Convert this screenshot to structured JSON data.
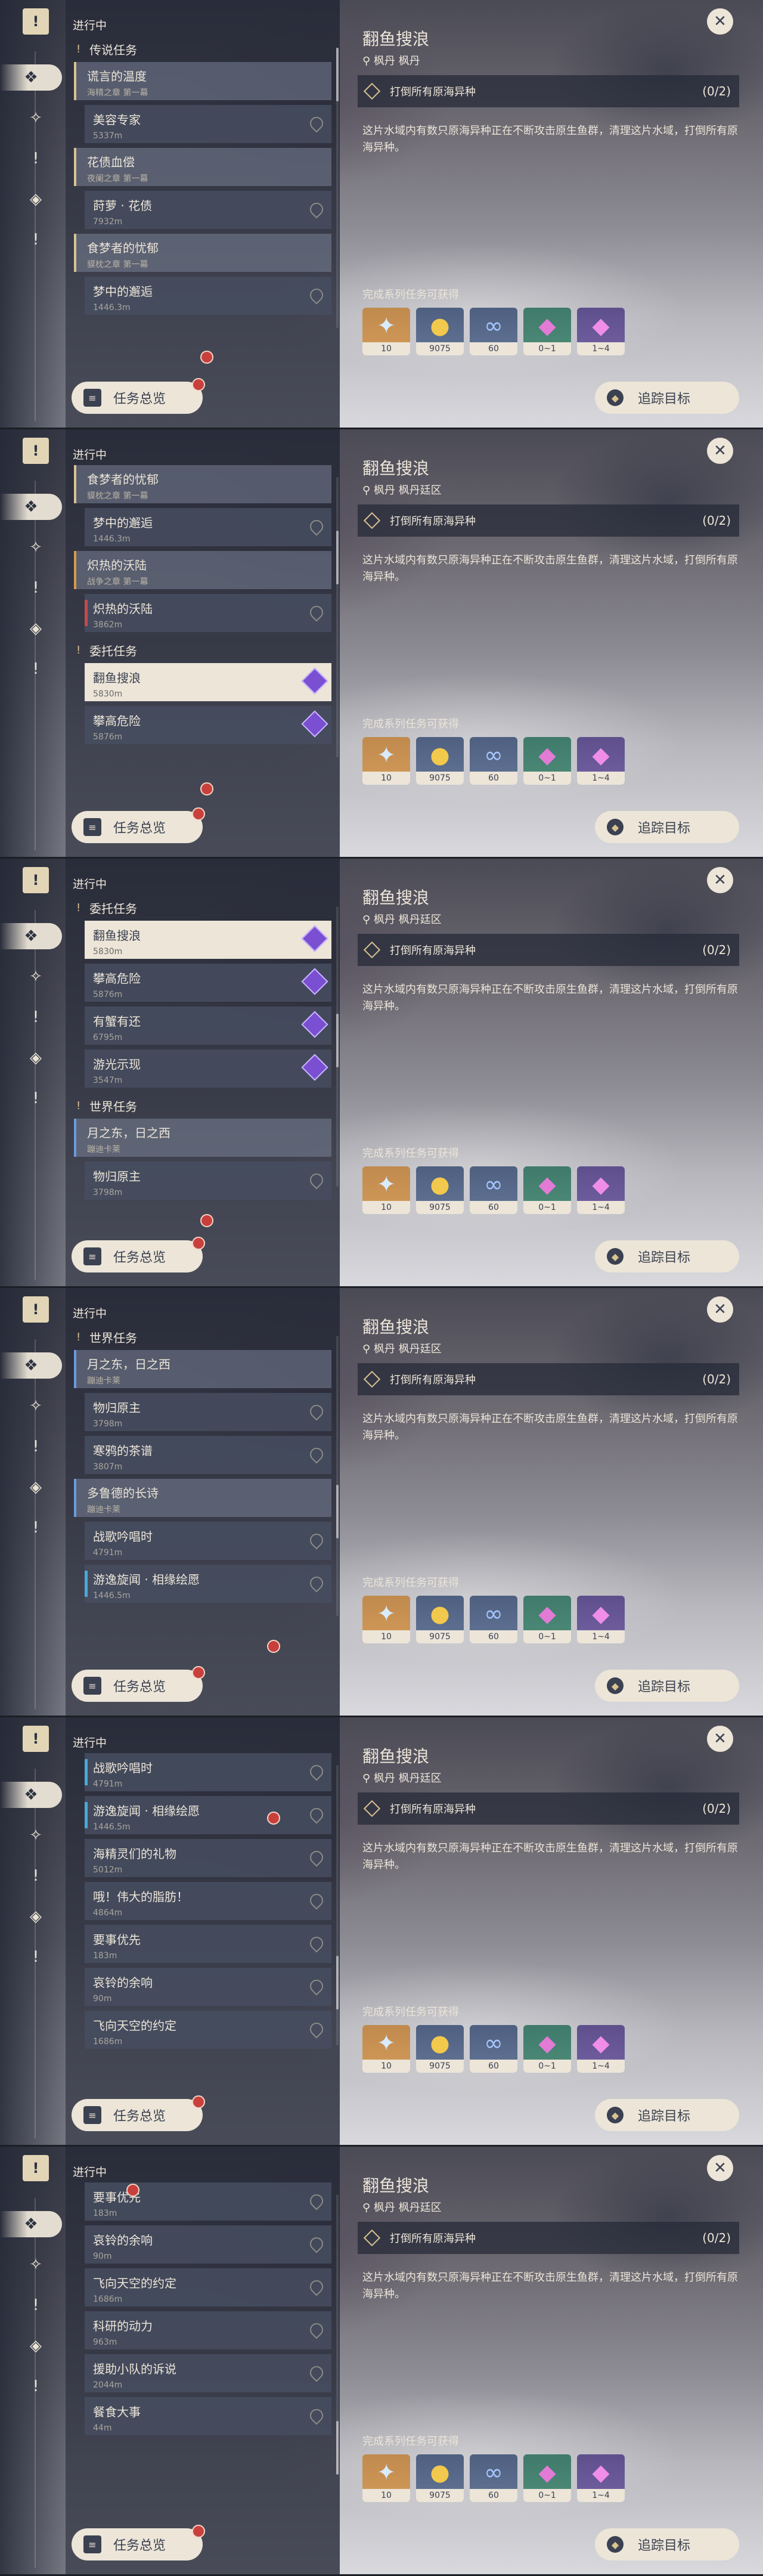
{
  "rail": {
    "top_icon": "!",
    "icons": [
      {
        "name": "quest-type-all-icon",
        "glyph": "❖"
      },
      {
        "name": "quest-type-archon-icon",
        "glyph": "✧"
      },
      {
        "name": "quest-type-story-icon",
        "glyph": "!"
      },
      {
        "name": "quest-type-commission-icon",
        "glyph": "◈"
      },
      {
        "name": "quest-type-world-icon",
        "glyph": "!"
      }
    ]
  },
  "list_header": "进行中",
  "buttons": {
    "overview": "任务总览",
    "track": "追踪目标"
  },
  "quest": {
    "title": "翻鱼搜浪",
    "location_frame1": "枫丹 枫丹",
    "location": "枫丹 枫丹廷区",
    "objective": "打倒所有原海异种",
    "progress": "(0/2)",
    "description": "这片水域内有数只原海异种正在不断攻击原生鱼群，清理这片水域，打倒所有原海异种。",
    "rewards_label": "完成系列任务可获得",
    "rewards": [
      {
        "name": "adventure-exp-icon",
        "glyph": "✦",
        "count": "10"
      },
      {
        "name": "mora-icon",
        "glyph": "●",
        "count": "9075"
      },
      {
        "name": "companionship-exp-icon",
        "glyph": "∞",
        "count": "60"
      },
      {
        "name": "primogem-icon",
        "glyph": "◆",
        "count": "0~1"
      },
      {
        "name": "crystal-icon",
        "glyph": "◆",
        "count": "1~4"
      }
    ]
  },
  "frames": [
    {
      "items": [
        {
          "kind": "cat",
          "title": "传说任务"
        },
        {
          "kind": "parent",
          "style": "leg",
          "title": "谎言的温度",
          "sub": "海精之章 第一幕"
        },
        {
          "kind": "sub",
          "title": "美容专家",
          "dist": "5337m"
        },
        {
          "kind": "parent",
          "style": "leg",
          "title": "花债血偿",
          "sub": "夜阑之章 第一幕"
        },
        {
          "kind": "sub",
          "title": "莳萝 · 花债",
          "dist": "7932m"
        },
        {
          "kind": "parent",
          "style": "leg",
          "title": "食梦者的忧郁",
          "sub": "貘枕之章 第一幕"
        },
        {
          "kind": "sub",
          "title": "梦中的邂逅",
          "dist": "1446.3m"
        }
      ]
    },
    {
      "items": [
        {
          "kind": "parent",
          "style": "leg",
          "title": "食梦者的忧郁",
          "sub": "貘枕之章 第一幕"
        },
        {
          "kind": "sub",
          "title": "梦中的邂逅",
          "dist": "1446.3m"
        },
        {
          "kind": "parent",
          "style": "arch",
          "title": "炽热的沃陆",
          "sub": "战争之章 第一幕"
        },
        {
          "kind": "sub",
          "title": "炽热的沃陆",
          "dist": "3862m",
          "stripe": "red"
        },
        {
          "kind": "cat",
          "title": "委托任务"
        },
        {
          "kind": "sub",
          "title": "翻鱼搜浪",
          "dist": "5830m",
          "active": true,
          "gem": true
        },
        {
          "kind": "sub",
          "title": "攀高危险",
          "dist": "5876m",
          "gem": true
        }
      ]
    },
    {
      "items": [
        {
          "kind": "cat",
          "title": "委托任务"
        },
        {
          "kind": "sub",
          "title": "翻鱼搜浪",
          "dist": "5830m",
          "active": true,
          "gem": true
        },
        {
          "kind": "sub",
          "title": "攀高危险",
          "dist": "5876m",
          "gem": true
        },
        {
          "kind": "sub",
          "title": "有蟹有还",
          "dist": "6795m",
          "gem": true
        },
        {
          "kind": "sub",
          "title": "游光示现",
          "dist": "3547m",
          "gem": true
        },
        {
          "kind": "cat",
          "title": "世界任务"
        },
        {
          "kind": "parent",
          "style": "world",
          "title": "月之东，日之西",
          "sub": "蹦迪卡莱"
        },
        {
          "kind": "sub",
          "title": "物归原主",
          "dist": "3798m"
        }
      ]
    },
    {
      "items": [
        {
          "kind": "cat",
          "title": "世界任务"
        },
        {
          "kind": "parent",
          "style": "world",
          "title": "月之东，日之西",
          "sub": "蹦迪卡莱"
        },
        {
          "kind": "sub",
          "title": "物归原主",
          "dist": "3798m"
        },
        {
          "kind": "sub",
          "title": "寒鸦的茶谱",
          "dist": "3807m"
        },
        {
          "kind": "parent",
          "style": "world",
          "title": "多鲁德的长诗",
          "sub": "蹦迪卡莱"
        },
        {
          "kind": "sub",
          "title": "战歌吟唱时",
          "dist": "4791m"
        },
        {
          "kind": "sub",
          "title": "游逸旋闻 · 相缘绘愿",
          "dist": "1446.5m",
          "stripe": "cyan"
        }
      ]
    },
    {
      "items": [
        {
          "kind": "sub",
          "title": "战歌吟唱时",
          "dist": "4791m",
          "stripe": "cyan"
        },
        {
          "kind": "sub",
          "title": "游逸旋闻 · 相缘绘愿",
          "dist": "1446.5m",
          "stripe": "cyan"
        },
        {
          "kind": "sub",
          "title": "海精灵们的礼物",
          "dist": "5012m"
        },
        {
          "kind": "sub",
          "title": "哦！伟大的脂肪！",
          "dist": "4864m"
        },
        {
          "kind": "sub",
          "title": "要事优先",
          "dist": "183m"
        },
        {
          "kind": "sub",
          "title": "哀铃的余响",
          "dist": "90m"
        },
        {
          "kind": "sub",
          "title": "飞向天空的约定",
          "dist": "1686m"
        }
      ]
    },
    {
      "items": [
        {
          "kind": "sub",
          "title": "要事优先",
          "dist": "183m"
        },
        {
          "kind": "sub",
          "title": "哀铃的余响",
          "dist": "90m"
        },
        {
          "kind": "sub",
          "title": "飞向天空的约定",
          "dist": "1686m"
        },
        {
          "kind": "sub",
          "title": "科研的动力",
          "dist": "963m"
        },
        {
          "kind": "sub",
          "title": "援助小队的诉说",
          "dist": "2044m"
        },
        {
          "kind": "sub",
          "title": "餐食大事",
          "dist": "44m"
        }
      ]
    }
  ]
}
